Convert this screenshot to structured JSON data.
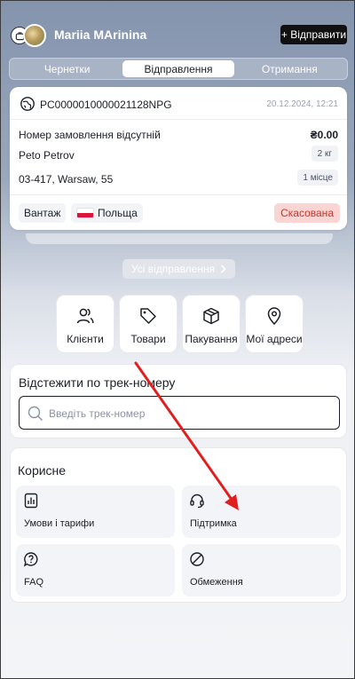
{
  "header": {
    "user_name": "Mariia MArinina",
    "send_label": "+ Відправити"
  },
  "tabs": [
    {
      "label": "Чернетки",
      "active": false
    },
    {
      "label": "Відправлення",
      "active": true
    },
    {
      "label": "Отримання",
      "active": false
    }
  ],
  "shipment": {
    "tracking_number": "PC0000010000021128NPG",
    "date": "20.12.2024, 12:21",
    "order_status_text": "Номер замовлення відсутній",
    "price": "₴0.00",
    "recipient": "Peto Petrov",
    "weight": "2 кг",
    "address": "03-417, Warsaw, 55",
    "places": "1 місце",
    "type_chip": "Вантаж",
    "country_chip": "Польща",
    "status": "Скасована"
  },
  "all_shipments_label": "Усі відправлення",
  "quick_actions": [
    {
      "label": "Клієнти",
      "icon": "users-icon"
    },
    {
      "label": "Товари",
      "icon": "tag-icon"
    },
    {
      "label": "Пакування",
      "icon": "box-icon"
    },
    {
      "label": "Мої адреси",
      "icon": "location-pin-icon"
    }
  ],
  "track": {
    "title": "Відстежити по трек-номеру",
    "placeholder": "Введіть трек-номер"
  },
  "useful": {
    "title": "Корисне",
    "tiles": [
      {
        "label": "Умови і тарифи",
        "icon": "chart-document-icon"
      },
      {
        "label": "Підтримка",
        "icon": "headset-icon"
      },
      {
        "label": "FAQ",
        "icon": "question-bubble-icon"
      },
      {
        "label": "Обмеження",
        "icon": "prohibited-icon"
      }
    ]
  },
  "colors": {
    "accent_dark": "#111111",
    "status_cancelled_bg": "#fbd4d4",
    "status_cancelled_text": "#c0392b",
    "annotation_arrow": "#e02020"
  }
}
